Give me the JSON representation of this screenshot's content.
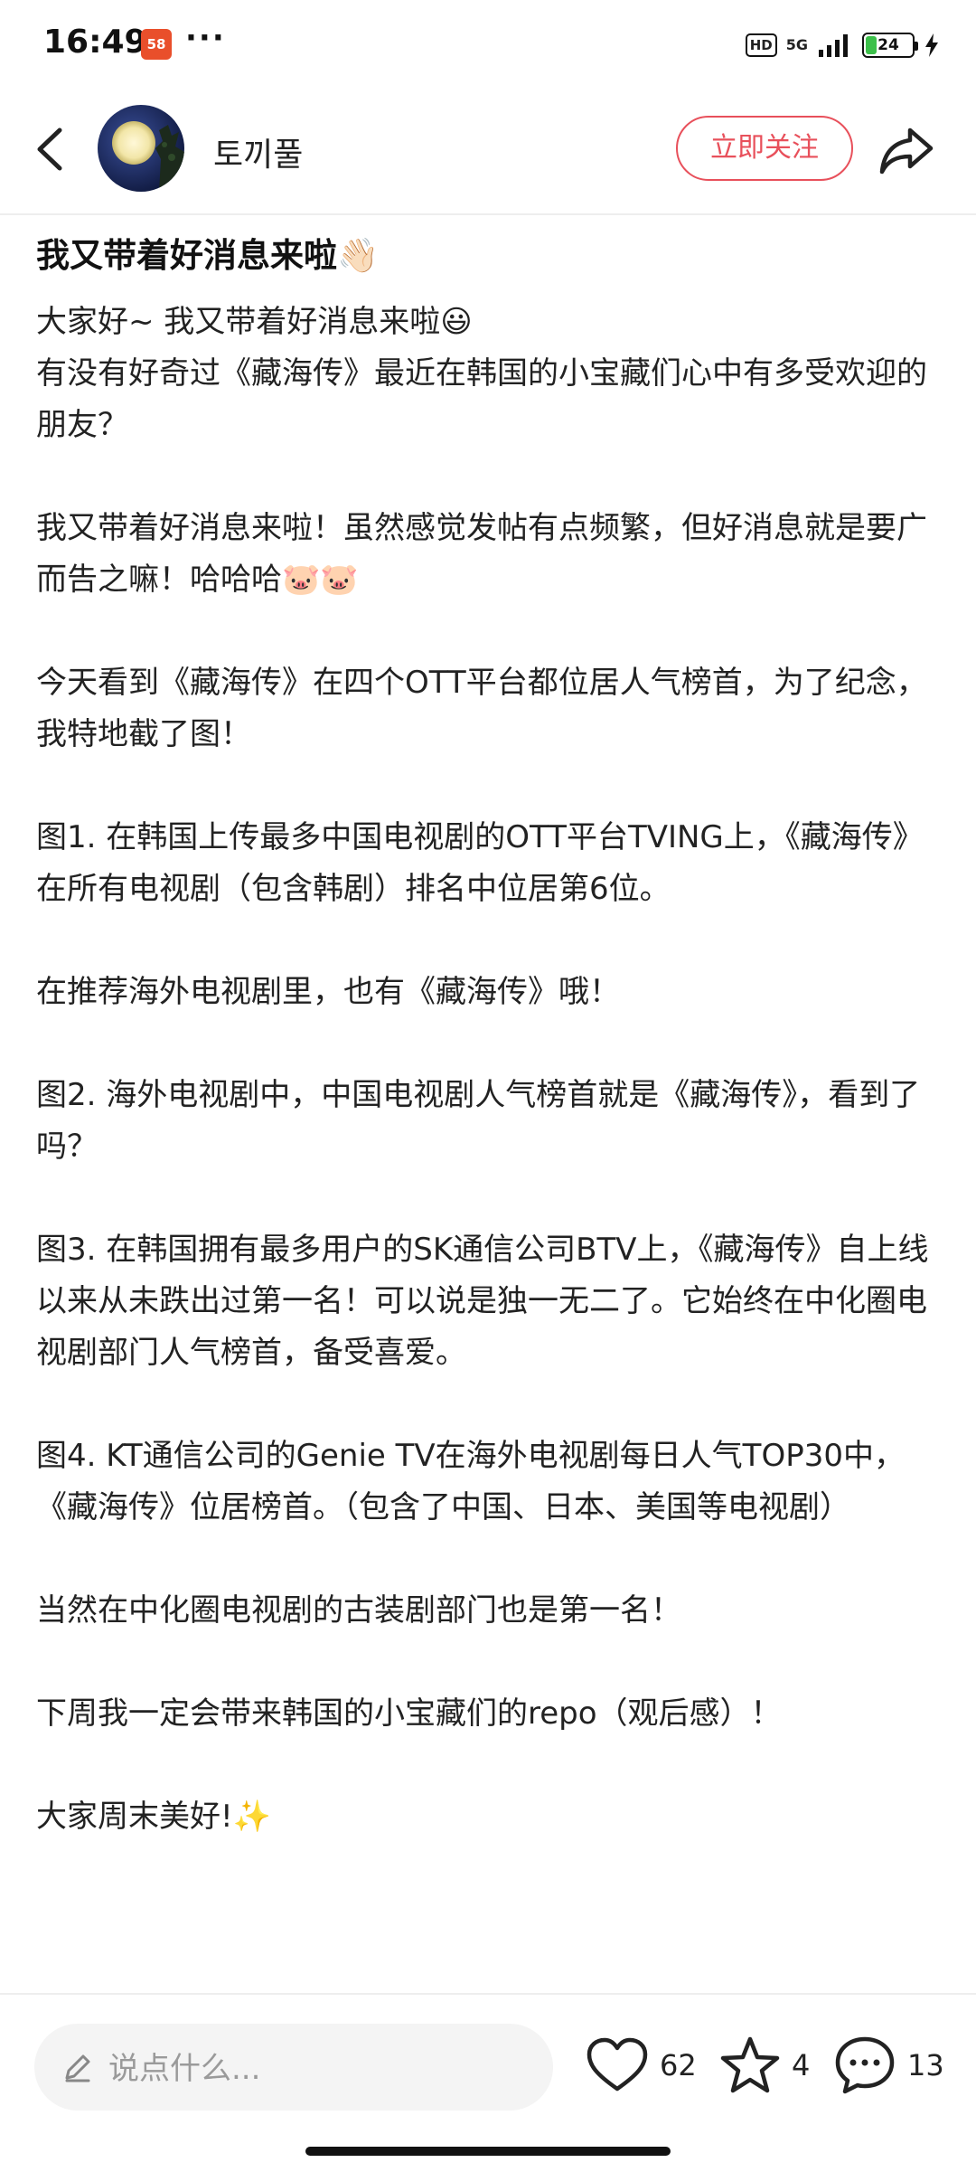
{
  "status_bar": {
    "time": "16:49",
    "app_badge": "58",
    "more_dots": "···",
    "hd_label": "HD",
    "network_label": "5G",
    "battery_level": "24",
    "battery_fraction": 0.24
  },
  "header": {
    "back_icon": "chevron-left-icon",
    "username": "토끼풀",
    "follow_label": "立即关注",
    "share_icon": "share-icon"
  },
  "post": {
    "title": "我又带着好消息来啦👋🏻",
    "paragraphs": [
      "大家好~ 我又带着好消息来啦😃\n有没有好奇过《藏海传》最近在韩国的小宝藏们心中有多受欢迎的朋友？",
      "我又带着好消息来啦！虽然感觉发帖有点频繁，但好消息就是要广而告之嘛！哈哈哈🐷🐷",
      "今天看到《藏海传》在四个OTT平台都位居人气榜首，为了纪念，我特地截了图！",
      "图1. 在韩国上传最多中国电视剧的OTT平台TVING上，《藏海传》在所有电视剧（包含韩剧）排名中位居第6位。",
      "在推荐海外电视剧里，也有《藏海传》哦！",
      "图2. 海外电视剧中，中国电视剧人气榜首就是《藏海传》，看到了吗？",
      "图3. 在韩国拥有最多用户的SK通信公司BTV上，《藏海传》自上线以来从未跌出过第一名！可以说是独一无二了。它始终在中化圈电视剧部门人气榜首，备受喜爱。",
      "图4. KT通信公司的Genie TV在海外电视剧每日人气TOP30中，《藏海传》位居榜首。（包含了中国、日本、美国等电视剧）",
      "当然在中化圈电视剧的古装剧部门也是第一名！",
      "下周我一定会带来韩国的小宝藏们的repo（观后感）！",
      "大家周末美好!✨"
    ]
  },
  "bottom_bar": {
    "comment_placeholder": "说点什么...",
    "like_count": "62",
    "favorite_count": "4",
    "comment_count": "13"
  },
  "colors": {
    "accent": "#e8505b",
    "battery_green": "#3cc04a",
    "badge_orange": "#e94f2b"
  }
}
